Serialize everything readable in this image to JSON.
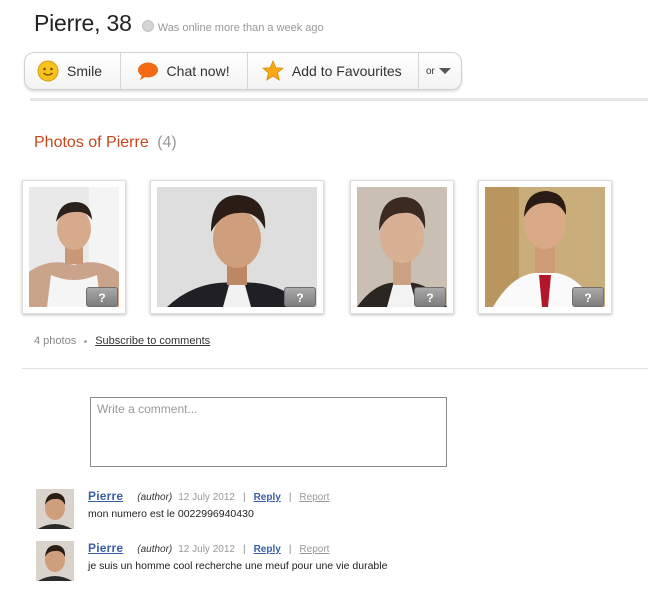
{
  "profile": {
    "name": "Pierre, 38",
    "online_status": "Was online more than a week ago"
  },
  "actions": {
    "smile": "Smile",
    "chat": "Chat now!",
    "favourites": "Add to Favourites",
    "more": "or"
  },
  "photos": {
    "title": "Photos of Pierre",
    "count": "(4)",
    "items": [
      {
        "badge": "?"
      },
      {
        "badge": "?"
      },
      {
        "badge": "?"
      },
      {
        "badge": "?"
      }
    ],
    "meta_count": "4 photos",
    "subscribe": "Subscribe to comments"
  },
  "comment_input": {
    "placeholder": "Write a comment..."
  },
  "comments": [
    {
      "author": "Pierre",
      "role": "(author)",
      "date": "12 July 2012",
      "reply": "Reply",
      "report": "Report",
      "text": "mon numero est le 0022996940430"
    },
    {
      "author": "Pierre",
      "role": "(author)",
      "date": "12 July 2012",
      "reply": "Reply",
      "report": "Report",
      "text": "je suis un homme cool recherche une meuf pour une vie durable"
    }
  ],
  "colors": {
    "accent_title": "#c8461c",
    "link_blue": "#3a5fa4",
    "muted": "#999999"
  },
  "icons": {
    "smile": "smiley-face-icon",
    "chat": "speech-bubble-icon",
    "favourites": "star-icon",
    "more": "chevron-down-icon",
    "status": "offline-dot-icon"
  }
}
